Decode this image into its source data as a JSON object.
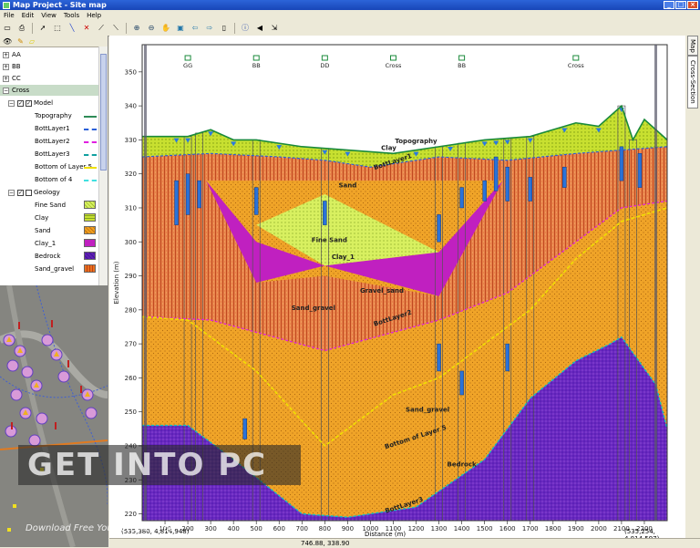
{
  "window": {
    "title": "Map Project - Site map"
  },
  "menu": [
    "File",
    "Edit",
    "View",
    "Tools",
    "Help"
  ],
  "toolbar_icons": [
    "new-icon",
    "print-icon",
    "pointer-icon",
    "select-icon",
    "line-icon",
    "delete-icon",
    "measure-icon",
    "slope-icon",
    "zoom-in-icon",
    "zoom-out-icon",
    "pan-icon",
    "full-extent-icon",
    "back-icon",
    "forward-icon",
    "refresh-icon",
    "info-icon",
    "sound-icon",
    "export-icon"
  ],
  "tree": {
    "sections": [
      "AA",
      "BB",
      "CC",
      "Cross"
    ],
    "model": {
      "label": "Model",
      "items": [
        {
          "label": "Topography",
          "color": "#2e8b57"
        },
        {
          "label": "BottLayer1",
          "color": "#2a5fd8"
        },
        {
          "label": "BottLayer2",
          "color": "#e020e0"
        },
        {
          "label": "BottLayer3",
          "color": "#10a0a0"
        },
        {
          "label": "Bottom of Layer 5",
          "color": "#f0e000"
        },
        {
          "label": "Bottom of 4",
          "color": "#40e0e0"
        }
      ]
    },
    "geology": {
      "label": "Geology",
      "items": [
        {
          "label": "Fine Sand",
          "color": "#d8f060"
        },
        {
          "label": "Clay",
          "color": "#c8e030"
        },
        {
          "label": "Sand",
          "color": "#f0a020"
        },
        {
          "label": "Clay_1",
          "color": "#c020c0"
        },
        {
          "label": "Bedrock",
          "color": "#6020b0"
        },
        {
          "label": "Sand_gravel",
          "color": "#e87020"
        }
      ]
    }
  },
  "right_tabs": [
    "Map",
    "Cross-Section"
  ],
  "chart_data": {
    "type": "cross-section",
    "xlabel": "Distance (m)",
    "ylabel": "Elevation (m)",
    "xlim": [
      0,
      2300
    ],
    "ylim": [
      218,
      358
    ],
    "x_ticks": [
      100,
      200,
      300,
      400,
      500,
      600,
      700,
      800,
      900,
      1000,
      1100,
      1200,
      1300,
      1400,
      1500,
      1600,
      1700,
      1800,
      1900,
      2000,
      2100,
      2200
    ],
    "y_ticks": [
      220,
      230,
      240,
      250,
      260,
      270,
      280,
      290,
      300,
      310,
      320,
      330,
      340,
      350
    ],
    "top_labels": [
      {
        "x": 200,
        "text": "GG"
      },
      {
        "x": 500,
        "text": "BB"
      },
      {
        "x": 800,
        "text": "DD"
      },
      {
        "x": 1100,
        "text": "Cross"
      },
      {
        "x": 1400,
        "text": "BB"
      },
      {
        "x": 1900,
        "text": "Cross"
      }
    ],
    "layer_labels": [
      {
        "x": 1080,
        "y": 327,
        "text": "Clay"
      },
      {
        "x": 1200,
        "y": 329,
        "text": "Topography"
      },
      {
        "x": 1100,
        "y": 323,
        "text": "BottLayer1"
      },
      {
        "x": 900,
        "y": 316,
        "text": "Sand"
      },
      {
        "x": 820,
        "y": 300,
        "text": "Fine Sand"
      },
      {
        "x": 880,
        "y": 295,
        "text": "Clay_1"
      },
      {
        "x": 1050,
        "y": 285,
        "text": "Gravel_sand"
      },
      {
        "x": 750,
        "y": 280,
        "text": "Sand_gravel"
      },
      {
        "x": 1100,
        "y": 277,
        "text": "BottLayer2"
      },
      {
        "x": 1250,
        "y": 250,
        "text": "Sand_gravel"
      },
      {
        "x": 1200,
        "y": 242,
        "text": "Bottom of Layer 5"
      },
      {
        "x": 1400,
        "y": 234,
        "text": "Bedrock"
      },
      {
        "x": 1150,
        "y": 222,
        "text": "BottLayer3"
      }
    ],
    "series": [
      {
        "name": "Topography",
        "x": [
          0,
          200,
          300,
          400,
          500,
          700,
          900,
          1100,
          1300,
          1500,
          1700,
          1900,
          2000,
          2100,
          2150,
          2200,
          2300
        ],
        "y": [
          331,
          331,
          333,
          330,
          330,
          328,
          327,
          326,
          328,
          330,
          331,
          335,
          334,
          340,
          330,
          336,
          330
        ]
      },
      {
        "name": "BottLayer1",
        "x": [
          0,
          300,
          600,
          800,
          1000,
          1300,
          1600,
          1900,
          2100,
          2300
        ],
        "y": [
          325,
          326,
          325,
          324,
          322,
          325,
          324,
          326,
          327,
          328
        ]
      },
      {
        "name": "BottLayer2",
        "x": [
          0,
          300,
          800,
          1300,
          1600,
          1900,
          2100,
          2300
        ],
        "y": [
          278,
          277,
          268,
          277,
          285,
          300,
          310,
          312
        ]
      },
      {
        "name": "Bottom of Layer 5",
        "x": [
          0,
          200,
          500,
          800,
          1100,
          1300,
          1500,
          1700,
          1900,
          2100,
          2300
        ],
        "y": [
          278,
          277,
          262,
          240,
          255,
          260,
          270,
          280,
          295,
          306,
          310
        ]
      },
      {
        "name": "BottLayer3",
        "x": [
          0,
          200,
          400,
          700,
          900,
          1200,
          1500,
          1700,
          1900,
          2050,
          2100,
          2250,
          2300
        ],
        "y": [
          246,
          246,
          236,
          220,
          219,
          222,
          236,
          254,
          265,
          270,
          272,
          258,
          245
        ]
      }
    ]
  },
  "status": {
    "left_coords": "(535,380, 4,814,948)",
    "cursor": "746.88, 338.90",
    "right_coords": "(535,254, 4,814,597)"
  },
  "watermark": {
    "text": "GET INTO PC",
    "sub": "Download Free Your Desired App"
  }
}
